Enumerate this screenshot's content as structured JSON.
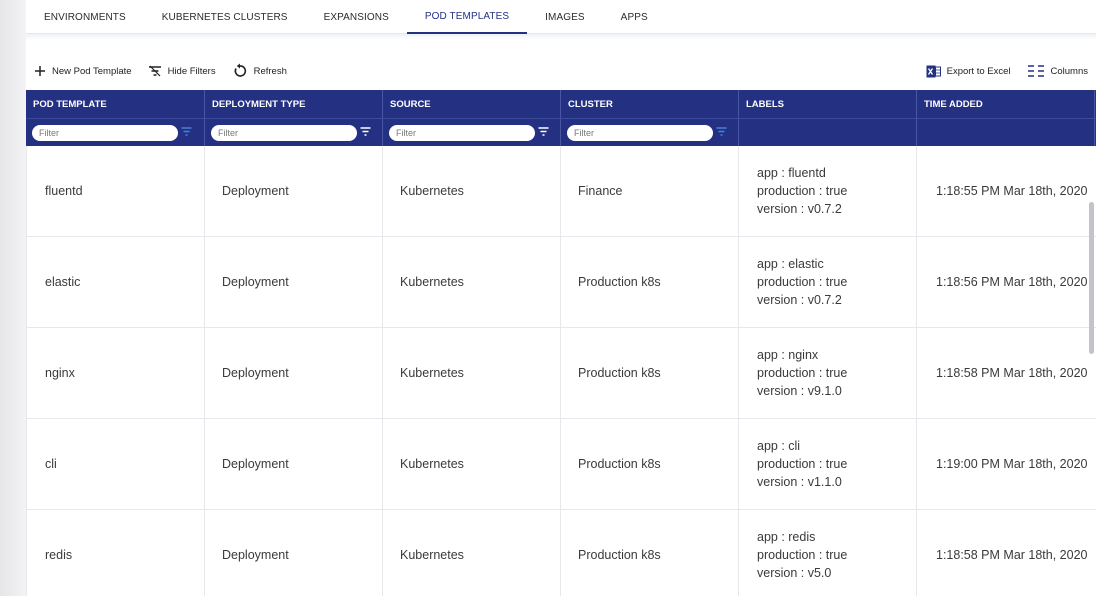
{
  "tabs": [
    {
      "label": "ENVIRONMENTS",
      "active": false
    },
    {
      "label": "KUBERNETES CLUSTERS",
      "active": false
    },
    {
      "label": "EXPANSIONS",
      "active": false
    },
    {
      "label": "POD TEMPLATES",
      "active": true
    },
    {
      "label": "IMAGES",
      "active": false
    },
    {
      "label": "APPS",
      "active": false
    }
  ],
  "toolbar": {
    "new_pod_template": "New Pod Template",
    "hide_filters": "Hide Filters",
    "refresh": "Refresh",
    "export_to_excel": "Export to Excel",
    "columns": "Columns"
  },
  "grid": {
    "headers": [
      "POD TEMPLATE",
      "DEPLOYMENT TYPE",
      "SOURCE",
      "CLUSTER",
      "LABELS",
      "TIME ADDED"
    ],
    "filter_placeholder": "Filter",
    "rows": [
      {
        "name": "fluentd",
        "type": "Deployment",
        "source": "Kubernetes",
        "cluster": "Finance",
        "labels": [
          "app : fluentd",
          "production : true",
          "version : v0.7.2"
        ],
        "time": "1:18:55 PM Mar 18th, 2020"
      },
      {
        "name": "elastic",
        "type": "Deployment",
        "source": "Kubernetes",
        "cluster": "Production k8s",
        "labels": [
          "app : elastic",
          "production : true",
          "version : v0.7.2"
        ],
        "time": "1:18:56 PM Mar 18th, 2020"
      },
      {
        "name": "nginx",
        "type": "Deployment",
        "source": "Kubernetes",
        "cluster": "Production k8s",
        "labels": [
          "app : nginx",
          "production : true",
          "version : v9.1.0"
        ],
        "time": "1:18:58 PM Mar 18th, 2020"
      },
      {
        "name": "cli",
        "type": "Deployment",
        "source": "Kubernetes",
        "cluster": "Production k8s",
        "labels": [
          "app : cli",
          "production : true",
          "version : v1.1.0"
        ],
        "time": "1:19:00 PM Mar 18th, 2020"
      },
      {
        "name": "redis",
        "type": "Deployment",
        "source": "Kubernetes",
        "cluster": "Production k8s",
        "labels": [
          "app : redis",
          "production : true",
          "version : v5.0"
        ],
        "time": "1:18:58 PM Mar 18th, 2020"
      }
    ]
  },
  "colors": {
    "header_bg": "#243183",
    "active_tab": "#243183",
    "filter_icon": "#4a7fd6"
  }
}
